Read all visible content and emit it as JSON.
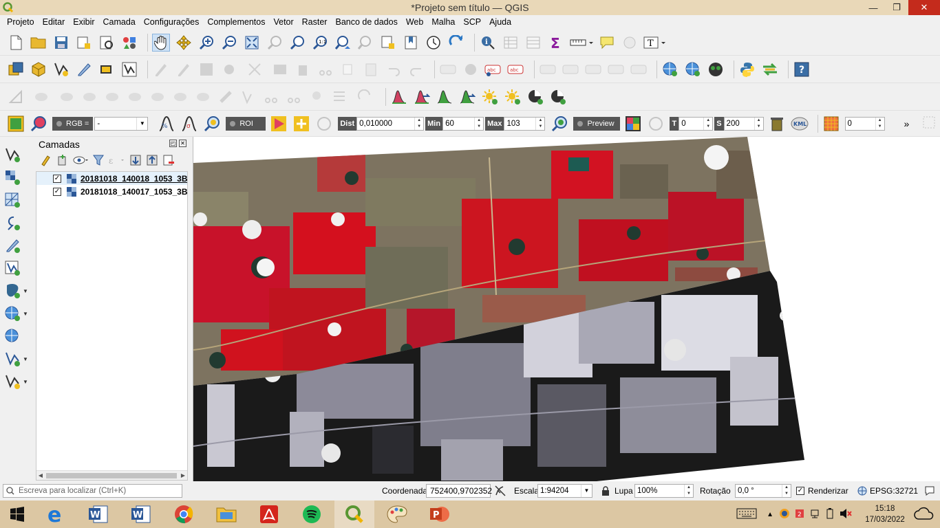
{
  "window": {
    "title": "*Projeto sem título — QGIS",
    "min": "—",
    "max": "❐",
    "close": "✕"
  },
  "menu": [
    "Projeto",
    "Editar",
    "Exibir",
    "Camada",
    "Configurações",
    "Complementos",
    "Vetor",
    "Raster",
    "Banco de dados",
    "Web",
    "Malha",
    "SCP",
    "Ajuda"
  ],
  "scp": {
    "rgb_label": "RGB =",
    "rgb_value": "-",
    "roi_label": "ROI",
    "dist_label": "Dist",
    "dist_value": "0,010000",
    "min_label": "Min",
    "min_value": "60",
    "max_label": "Max",
    "max_value": "103",
    "preview_label": "Preview",
    "t_label": "T",
    "t_value": "0",
    "s_label": "S",
    "s_value": "200",
    "kml_label": "KML",
    "band_value": "0",
    "more": "»"
  },
  "layers_panel": {
    "title": "Camadas",
    "items": [
      {
        "name": "20181018_140018_1053_3B",
        "checked": "✓",
        "selected": true
      },
      {
        "name": "20181018_140017_1053_3B",
        "checked": "✓",
        "selected": false
      }
    ]
  },
  "statusbar": {
    "locator_placeholder": "Escreva para localizar (Ctrl+K)",
    "coord_label": "Coordenada",
    "coord_value": "752400,9702352",
    "scale_label": "Escala",
    "scale_value": "1:94204",
    "magnifier_label": "Lupa",
    "magnifier_value": "100%",
    "rotation_label": "Rotação",
    "rotation_value": "0,0 °",
    "render_label": "Renderizar",
    "render_checked": "✓",
    "crs": "EPSG:32721"
  },
  "taskbar": {
    "time": "15:18",
    "date": "17/03/2022"
  },
  "colors": {
    "titlebar": "#e9d8b8",
    "taskbar": "#dcc7a3",
    "close_red": "#c42b1c",
    "vegetation_red": "#d4101e"
  },
  "icons": [
    "new-project",
    "open-project",
    "save-project",
    "pan",
    "zoom-in",
    "zoom-out",
    "identify",
    "sum",
    "measure",
    "python",
    "help",
    "windows-start",
    "edge",
    "word",
    "chrome",
    "file-explorer",
    "acrobat",
    "spotify",
    "qgis",
    "paint",
    "powerpoint"
  ]
}
